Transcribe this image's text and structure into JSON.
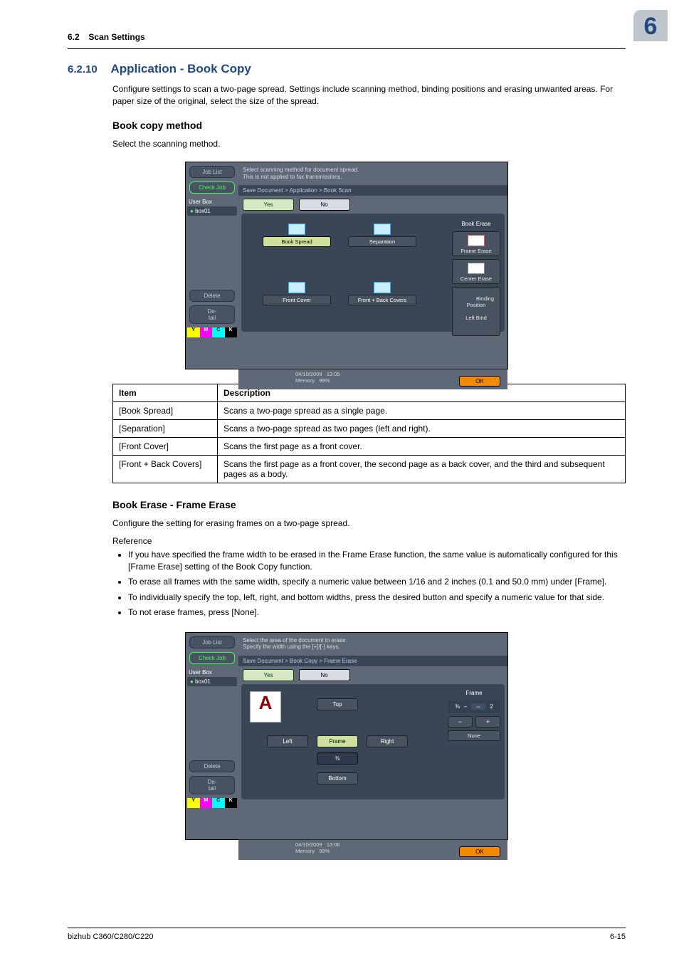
{
  "header": {
    "section_num": "6.2",
    "section_title": "Scan Settings",
    "chapter_num": "6"
  },
  "h1": {
    "num": "6.2.10",
    "title": "Application - Book Copy"
  },
  "intro": "Configure settings to scan a two-page spread. Settings include scanning method, binding positions and erasing unwanted areas. For paper size of the original, select the size of the spread.",
  "h2a": "Book copy method",
  "h2a_text": "Select the scanning method.",
  "panel1": {
    "hint_l1": "Select scanning method for document spread.",
    "hint_l2": "This is not applied to fax transmissions.",
    "crumb": "Save Document > Application > Book Scan",
    "yes": "Yes",
    "no": "No",
    "joblist": "Job List",
    "checkjob": "Check Job",
    "userbox_hdr": "User Box",
    "userbox_item": "box01",
    "delete": "Delete",
    "detail": "De-\ntail",
    "ok": "OK",
    "date": "04/10/2009",
    "time": "13:05",
    "mem_lbl": "Memory",
    "mem_val": "99%",
    "opts": {
      "o1": "Book Spread",
      "o2": "Separation",
      "o3": "Front Cover",
      "o4": "Front + Back Covers"
    },
    "right": {
      "hdr": "Book Erase",
      "b1": "Frame Erase",
      "b2": "Center Erase",
      "bind_hdr": "Binding\nPosition",
      "bind_val": "Left Bind"
    }
  },
  "table": {
    "h_item": "Item",
    "h_desc": "Description",
    "rows": [
      {
        "item": "[Book Spread]",
        "desc": "Scans a two-page spread as a single page."
      },
      {
        "item": "[Separation]",
        "desc": "Scans a two-page spread as two pages (left and right)."
      },
      {
        "item": "[Front Cover]",
        "desc": "Scans the first page as a front cover."
      },
      {
        "item": "[Front + Back Covers]",
        "desc": "Scans the first page as a front cover, the second page as a back cover, and the third and subsequent pages as a body."
      }
    ]
  },
  "h2b": "Book Erase - Frame Erase",
  "h2b_text": "Configure the setting for erasing frames on a two-page spread.",
  "ref_label": "Reference",
  "ref": [
    "If you have specified the frame width to be erased in the Frame Erase function, the same value is automatically configured for this [Frame Erase] setting of the Book Copy function.",
    "To erase all frames with the same width, specify a numeric value between 1/16 and 2 inches (0.1 and 50.0 mm) under [Frame].",
    "To individually specify the top, left, right, and bottom widths, press the desired button and specify a numeric value for that side.",
    "To not erase frames, press [None]."
  ],
  "panel2": {
    "hint_l1": "Select the area of the document to erase.",
    "hint_l2": "Specify the width using the [+]/[-] keys.",
    "crumb": "Save Document > Book Copy > Frame Erase",
    "yes": "Yes",
    "no": "No",
    "joblist": "Job List",
    "checkjob": "Check Job",
    "userbox_hdr": "User Box",
    "userbox_item": "box01",
    "delete": "Delete",
    "detail": "De-\ntail",
    "ok": "OK",
    "date": "04/10/2009",
    "time": "13:06",
    "mem_lbl": "Memory",
    "mem_val": "99%",
    "dirs": {
      "top": "Top",
      "left": "Left",
      "right": "Right",
      "bottom": "Bottom",
      "frame": "Frame"
    },
    "frame_val": "⅜",
    "right": {
      "hdr": "Frame",
      "frac_l": "⅜",
      "frac_r": "2",
      "dash": "–",
      "arrow": "⇔",
      "none": "None",
      "minus": "−",
      "plus": "+"
    },
    "a": "A"
  },
  "footer": {
    "left": "bizhub C360/C280/C220",
    "right": "6-15"
  }
}
